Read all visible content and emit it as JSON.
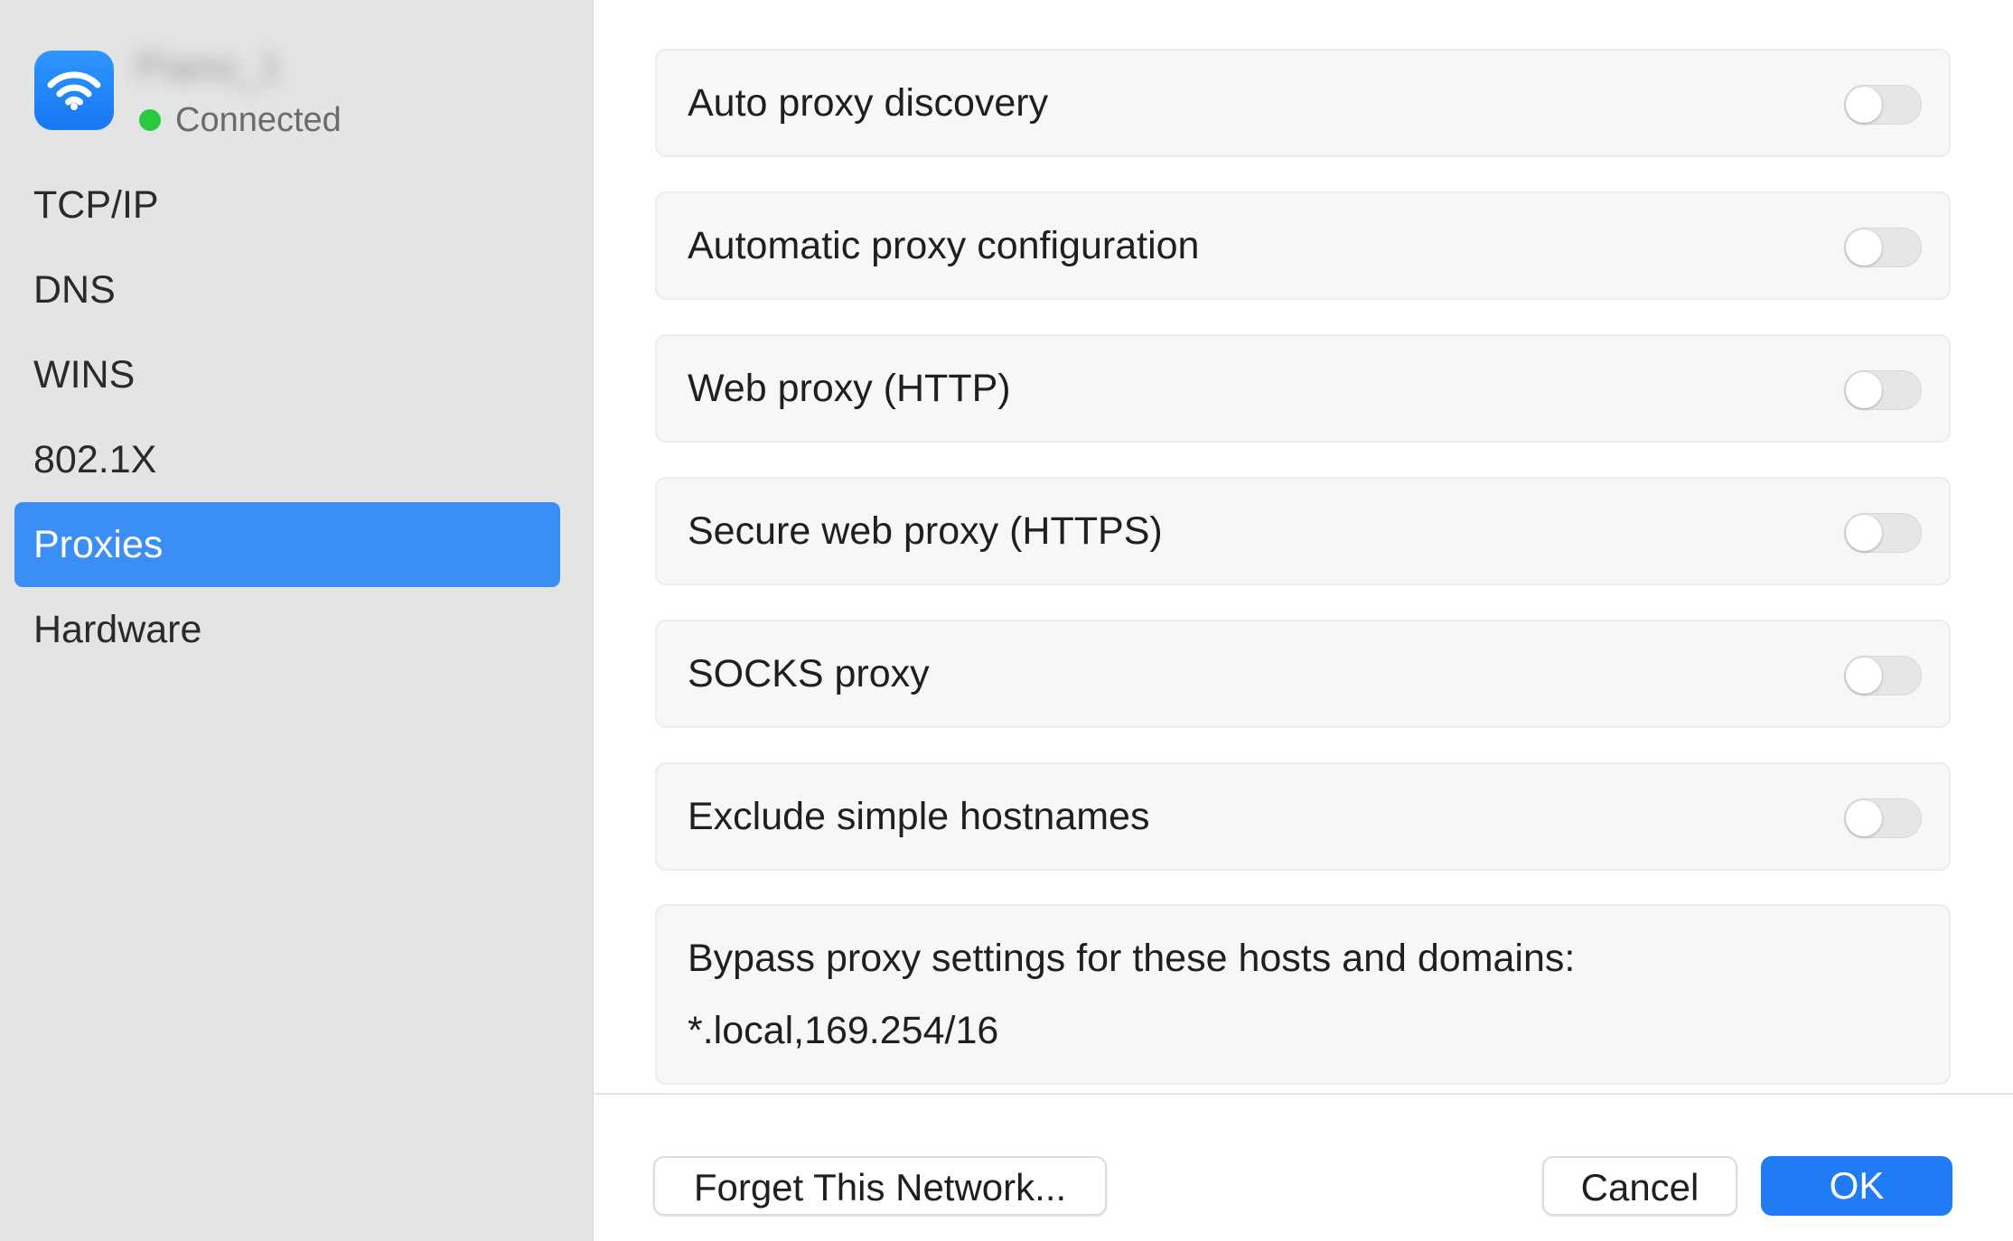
{
  "network": {
    "name": "Piano_1",
    "status": "Connected",
    "status_color": "#28c840",
    "icon": "wifi-icon"
  },
  "sidebar": {
    "items": [
      {
        "label": "TCP/IP",
        "active": false
      },
      {
        "label": "DNS",
        "active": false
      },
      {
        "label": "WINS",
        "active": false
      },
      {
        "label": "802.1X",
        "active": false
      },
      {
        "label": "Proxies",
        "active": true
      },
      {
        "label": "Hardware",
        "active": false
      }
    ],
    "active_color": "#3b8ef5"
  },
  "proxies": {
    "options": [
      {
        "label": "Auto proxy discovery",
        "enabled": false
      },
      {
        "label": "Automatic proxy configuration",
        "enabled": false
      },
      {
        "label": "Web proxy (HTTP)",
        "enabled": false
      },
      {
        "label": "Secure web proxy (HTTPS)",
        "enabled": false
      },
      {
        "label": "SOCKS proxy",
        "enabled": false
      },
      {
        "label": "Exclude simple hostnames",
        "enabled": false
      }
    ],
    "bypass": {
      "label": "Bypass proxy settings for these hosts and domains:",
      "value": "*.local,169.254/16"
    }
  },
  "footer": {
    "forget_label": "Forget This Network...",
    "cancel_label": "Cancel",
    "ok_label": "OK",
    "accent": "#1f7cf5"
  }
}
